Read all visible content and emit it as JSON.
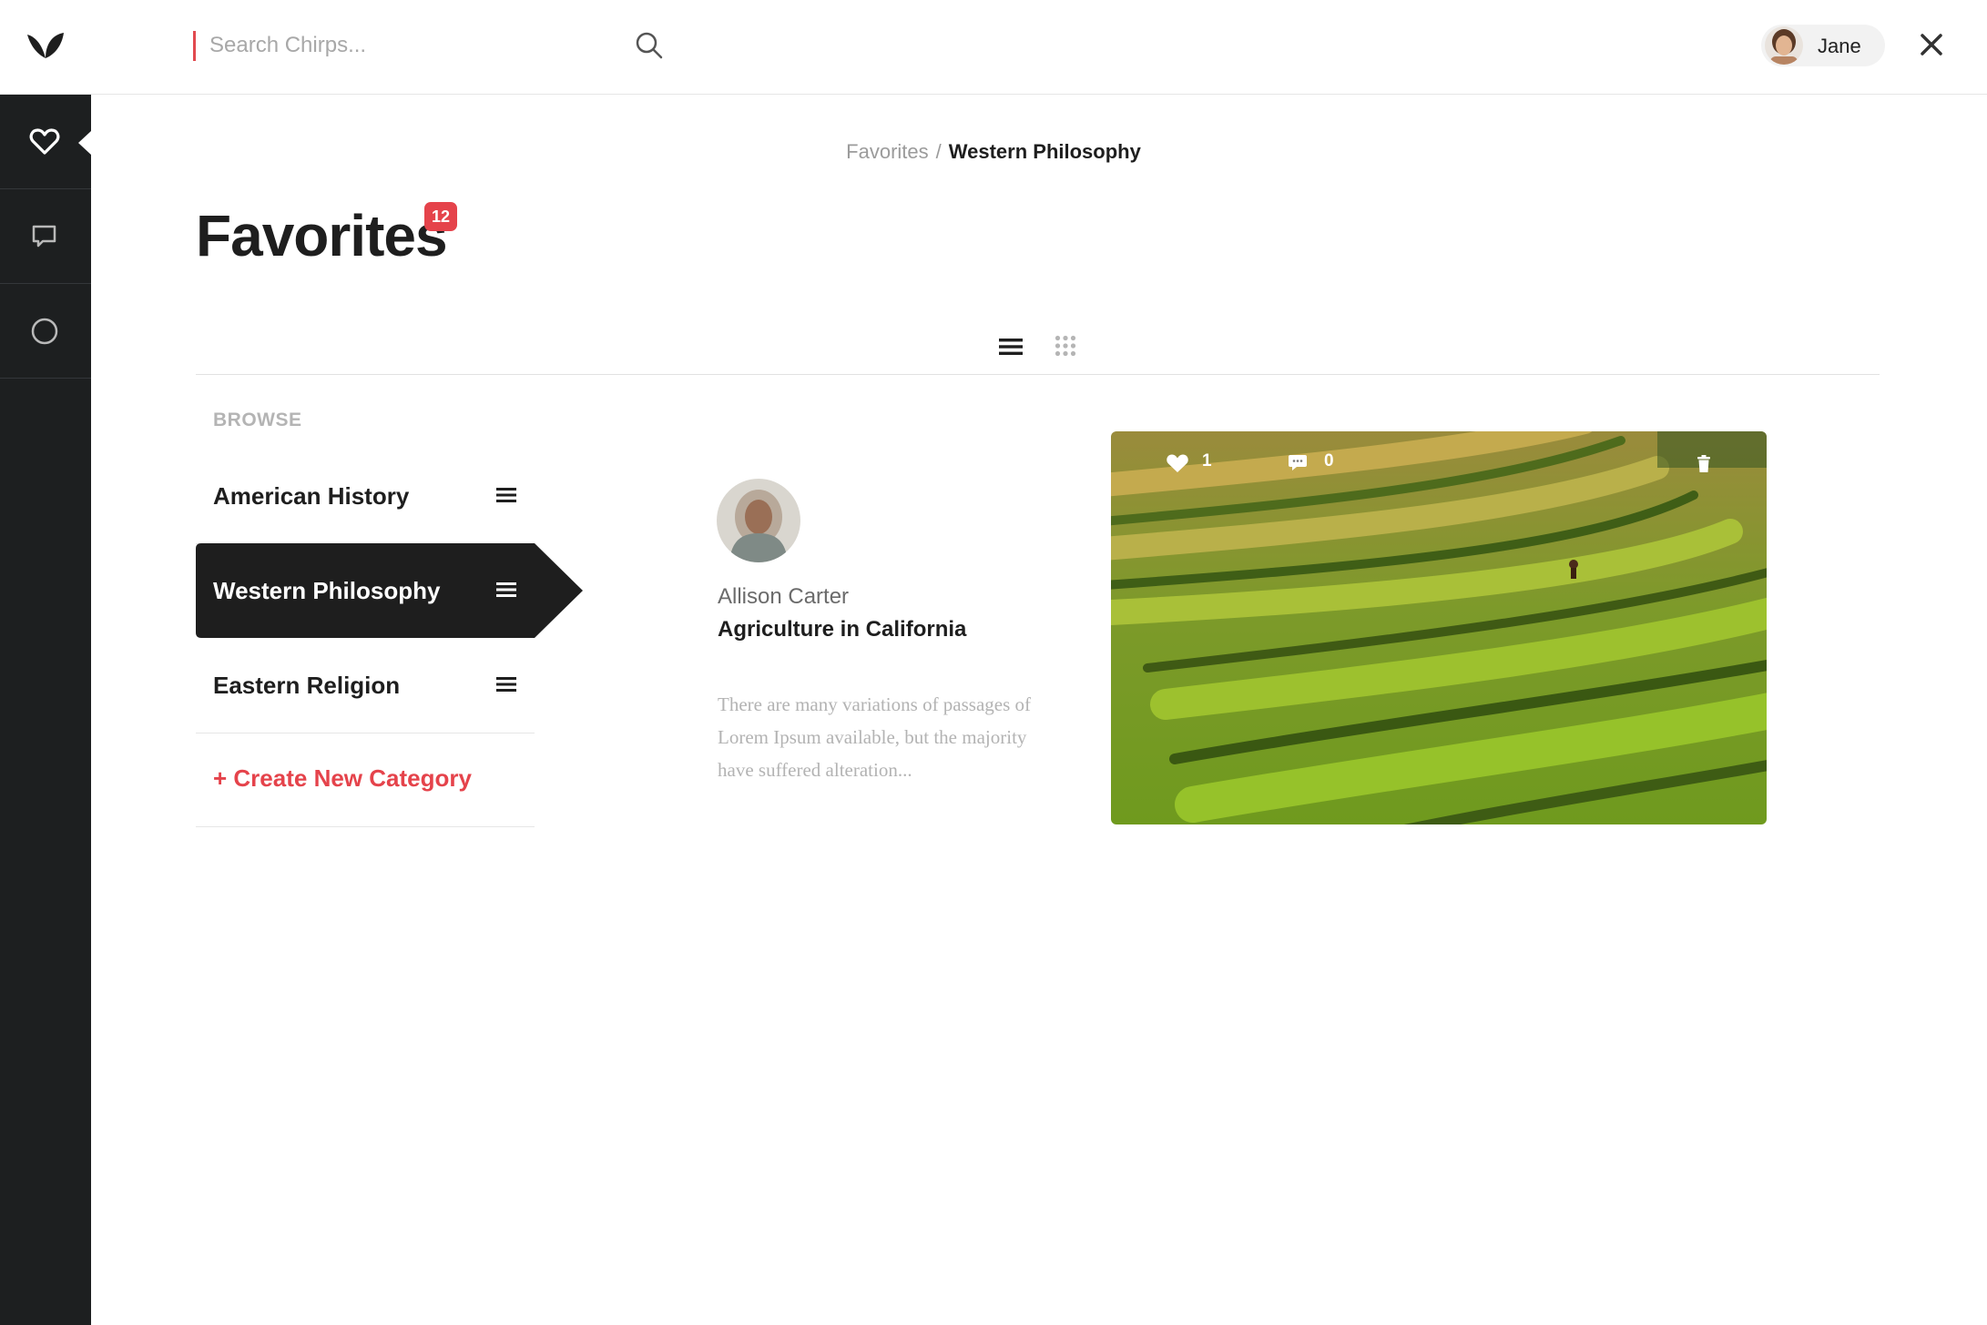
{
  "search": {
    "placeholder": "Search Chirps..."
  },
  "user": {
    "name": "Jane"
  },
  "breadcrumb": {
    "parent": "Favorites",
    "separator": "/",
    "current": "Western Philosophy"
  },
  "page": {
    "title": "Favorites",
    "count": "12"
  },
  "browse": {
    "label": "BROWSE",
    "categories": [
      {
        "label": "American History",
        "active": false
      },
      {
        "label": "Western Philosophy",
        "active": true
      },
      {
        "label": "Eastern Religion",
        "active": false
      }
    ],
    "create_label": "+ Create New Category"
  },
  "post": {
    "author": "Allison Carter",
    "title": "Agriculture in California",
    "excerpt": "There are many variations of passages of Lorem Ipsum available, but the majority have suffered alteration...",
    "likes": "1",
    "comments": "0"
  },
  "icons": {
    "rail": [
      "heart-icon",
      "chat-icon",
      "circle-icon"
    ],
    "view_toggles": [
      "list-view-icon",
      "grid-view-icon"
    ]
  },
  "colors": {
    "accent": "#e5434b",
    "rail": "#1d1f20",
    "active": "#1e1e1e"
  }
}
